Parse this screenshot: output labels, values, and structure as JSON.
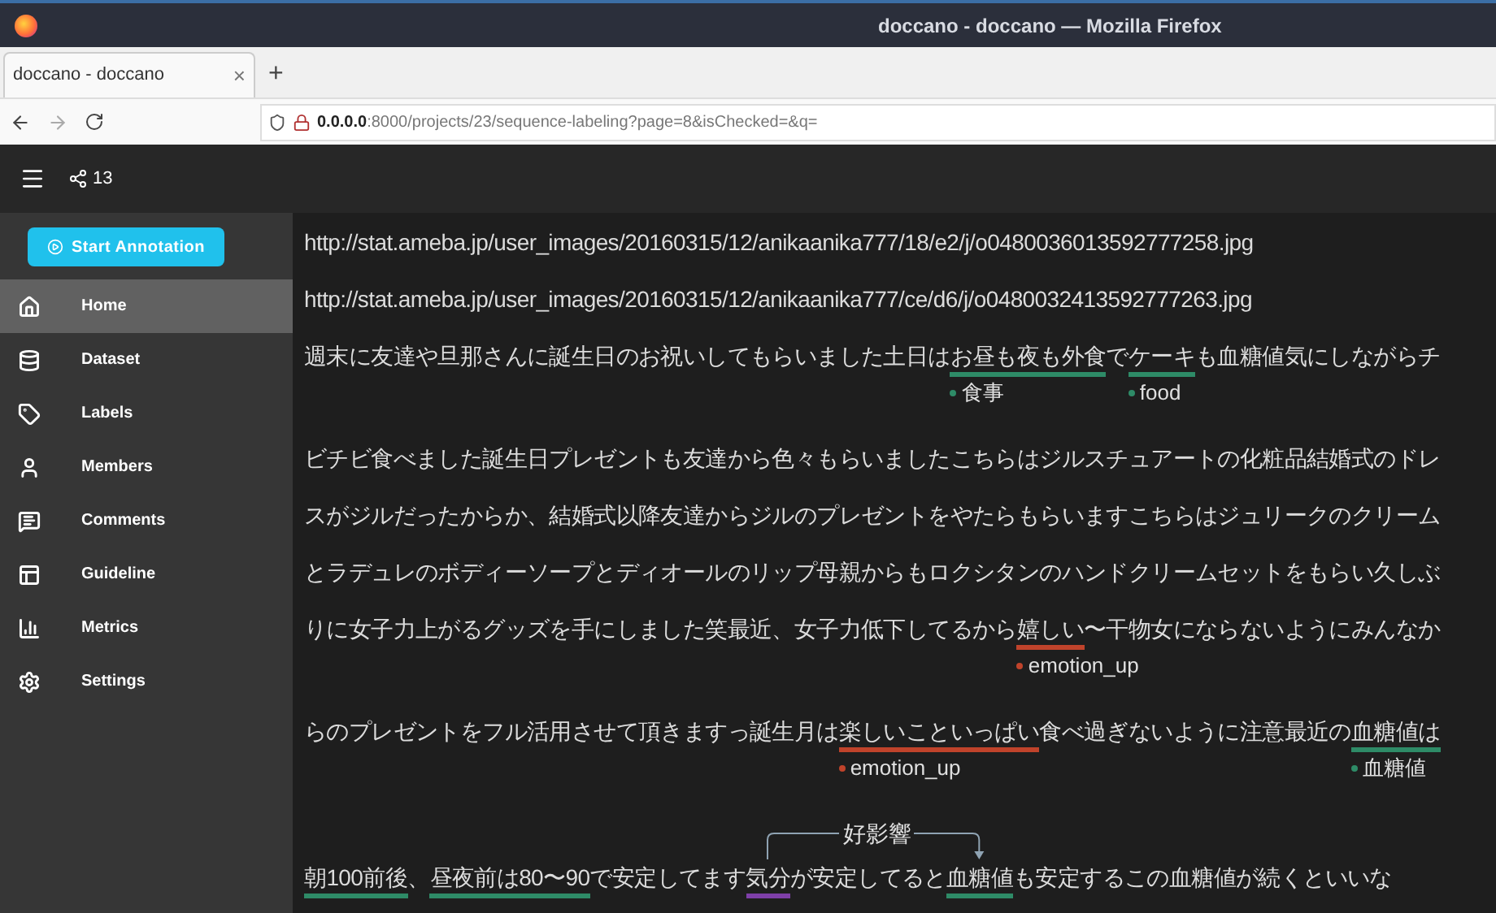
{
  "window": {
    "title": "doccano - doccano — Mozilla Firefox"
  },
  "tabs": [
    {
      "label": "doccano - doccano",
      "selected": true,
      "close": "×"
    }
  ],
  "new_tab": "+",
  "address_bar": {
    "host": "0.0.0.0",
    "path": ":8000/projects/23/sequence-labeling?page=8&isChecked=&q="
  },
  "app_bar": {
    "project_count": "13"
  },
  "sidebar": {
    "start_button": "Start Annotation",
    "items": [
      {
        "label": "Home",
        "selected": true
      },
      {
        "label": "Dataset",
        "selected": false
      },
      {
        "label": "Labels",
        "selected": false
      },
      {
        "label": "Members",
        "selected": false
      },
      {
        "label": "Comments",
        "selected": false
      },
      {
        "label": "Guideline",
        "selected": false
      },
      {
        "label": "Metrics",
        "selected": false
      },
      {
        "label": "Settings",
        "selected": false
      }
    ]
  },
  "document": {
    "lines": [
      {
        "segments": [
          {
            "text": "http://stat.ameba.jp/user_images/20160315/12/anikaanika777/18/e2/j/o0480036013592777258.jpg"
          }
        ]
      },
      {
        "segments": [
          {
            "text": "http://stat.ameba.jp/user_images/20160315/12/anikaanika777/ce/d6/j/o0480032413592777263.jpg"
          }
        ]
      },
      {
        "segments": [
          {
            "text": "週末に友達や旦那さんに誕生日のお祝いしてもらいました土日は"
          },
          {
            "text": "お昼も夜も外食",
            "color": "#2e8b67",
            "label": "食事"
          },
          {
            "text": "で"
          },
          {
            "text": "ケーキ",
            "color": "#2e8b67",
            "label": "food"
          },
          {
            "text": "も血糖値気にしながらチ"
          }
        ]
      },
      {
        "segments": [
          {
            "text": "ビチビ食べました誕生日プレゼントも友達から色々もらいましたこちらはジルスチュアートの化粧品結婚式のドレ"
          }
        ]
      },
      {
        "segments": [
          {
            "text": "スがジルだったからか、結婚式以降友達からジルのプレゼントをやたらもらいますこちらはジュリークのクリーム"
          }
        ]
      },
      {
        "segments": [
          {
            "text": "とラデュレのボディーソープとディオールのリップ母親からもロクシタンのハンドクリームセットをもらい久しぶ"
          }
        ]
      },
      {
        "segments": [
          {
            "text": "りに女子力上がるグッズを手にしました笑最近、女子力低下してるから"
          },
          {
            "text": "嬉しい",
            "color": "#c0432b",
            "label": "emotion_up"
          },
          {
            "text": "〜干物女にならないようにみんなか"
          }
        ]
      },
      {
        "segments": [
          {
            "text": "らのプレゼントをフル活用させて頂きますっ誕生月は"
          },
          {
            "text": "楽しいこといっぱい",
            "color": "#c0432b",
            "label": "emotion_up"
          },
          {
            "text": "食べ過ぎないように注意最近の"
          },
          {
            "text": "血糖値は",
            "color": "#2e8b67",
            "label": "血糖値"
          }
        ]
      },
      {
        "relation": "好影響",
        "segments": [
          {
            "text": "朝100前後",
            "color": "#2e8b67"
          },
          {
            "text": "、"
          },
          {
            "text": "昼夜前は80〜90",
            "color": "#2e8b67"
          },
          {
            "text": "で安定してます"
          },
          {
            "text": "気分",
            "color": "#7e3fa8",
            "relation_start": true
          },
          {
            "text": "が安定してると"
          },
          {
            "text": "血糖値",
            "color": "#2e8b67",
            "relation_end": true
          },
          {
            "text": "も安定するこの血糖値が続くといいな"
          }
        ]
      }
    ]
  }
}
